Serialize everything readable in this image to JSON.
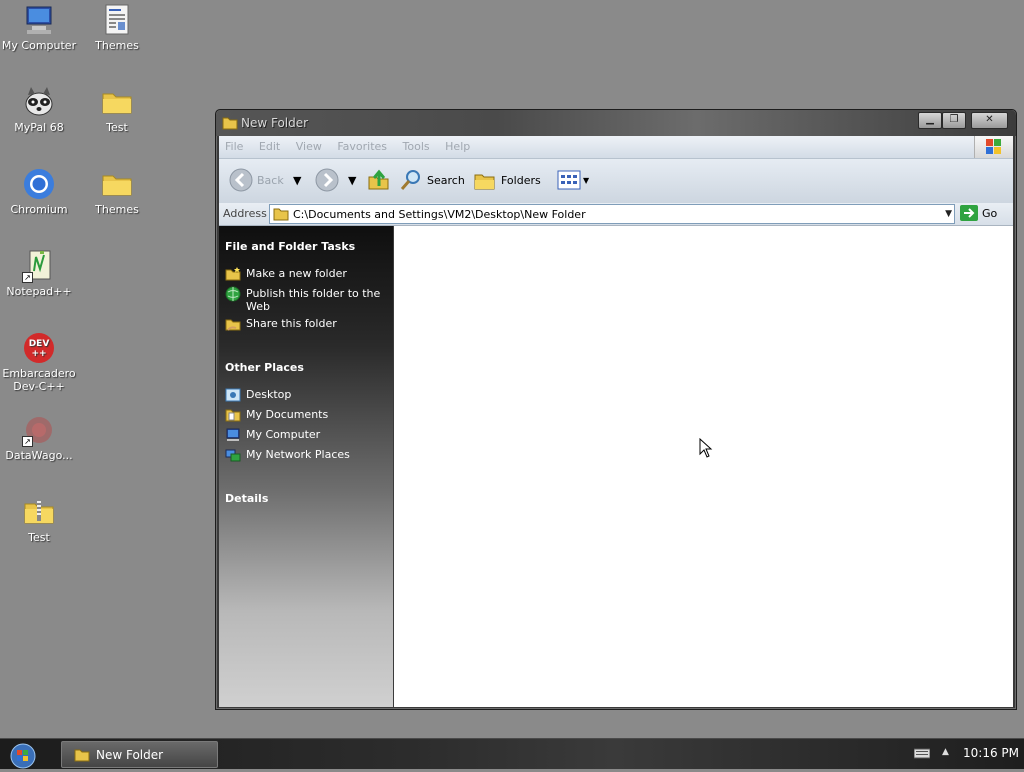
{
  "desktop": {
    "icons": [
      {
        "label": "My Computer",
        "icon": "computer-icon"
      },
      {
        "label": "Themes",
        "icon": "document-icon"
      },
      {
        "label": "MyPal 68",
        "icon": "raccoon-icon"
      },
      {
        "label": "Test",
        "icon": "folder-icon"
      },
      {
        "label": "Chromium",
        "icon": "chromium-icon"
      },
      {
        "label": "Themes",
        "icon": "folder-icon"
      },
      {
        "label": "Notepad++",
        "icon": "notepad-icon"
      },
      {
        "label": "Embarcadero Dev-C++",
        "icon": "devcpp-icon"
      },
      {
        "label": "DataWago...",
        "icon": "datawagon-icon"
      },
      {
        "label": "Test",
        "icon": "zip-folder-icon"
      }
    ],
    "devcpp_badge": "DEV\n++"
  },
  "window": {
    "title": "New Folder",
    "menu": [
      "File",
      "Edit",
      "View",
      "Favorites",
      "Tools",
      "Help"
    ],
    "toolbar": {
      "back": "Back",
      "search": "Search",
      "folders": "Folders"
    },
    "address": {
      "label": "Address",
      "path": "C:\\Documents and Settings\\VM2\\Desktop\\New Folder",
      "go": "Go"
    },
    "sidebar": {
      "file_tasks_title": "File and Folder Tasks",
      "file_tasks": [
        "Make a new folder",
        "Publish this folder to the Web",
        "Share this folder"
      ],
      "other_places_title": "Other Places",
      "other_places": [
        "Desktop",
        "My Documents",
        "My Computer",
        "My Network Places"
      ],
      "details_title": "Details"
    }
  },
  "taskbar": {
    "open_window": "New Folder",
    "clock": "10:16 PM"
  },
  "colors": {
    "desktop_bg": "#8a8a8a",
    "content_bg": "#ffffff",
    "accent_green": "#2fa340"
  }
}
